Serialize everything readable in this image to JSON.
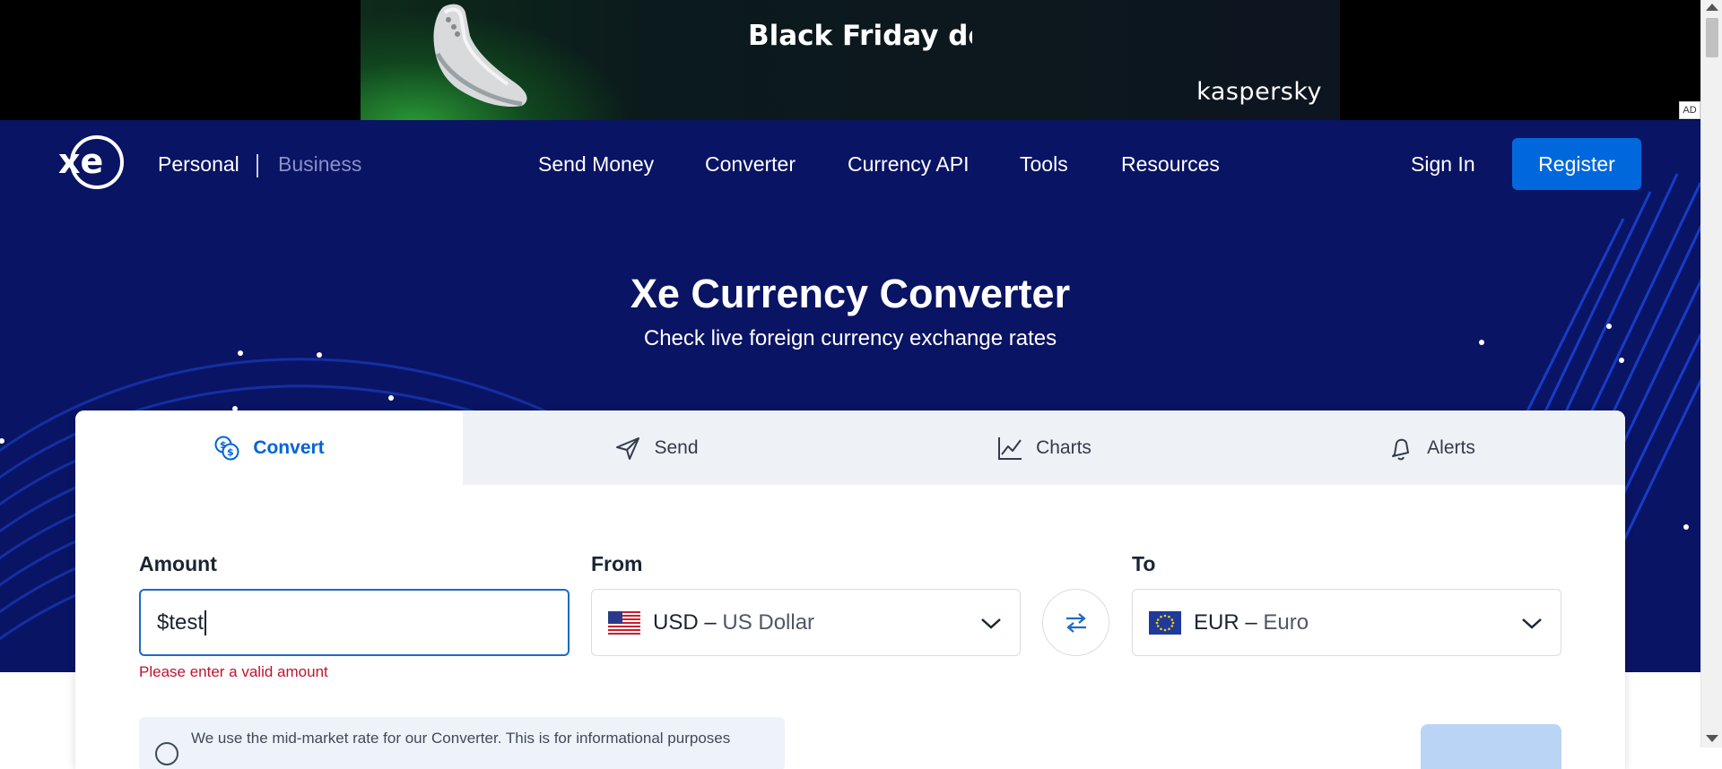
{
  "ad": {
    "headline": "Black Friday deals",
    "brand": "kaspersky",
    "tag": "AD"
  },
  "nav": {
    "personal": "Personal",
    "business": "Business",
    "links": [
      "Send Money",
      "Converter",
      "Currency API",
      "Tools",
      "Resources"
    ],
    "sign_in": "Sign In",
    "register": "Register"
  },
  "hero": {
    "title": "Xe Currency Converter",
    "subtitle": "Check live foreign currency exchange rates"
  },
  "tabs": [
    {
      "label": "Convert",
      "icon": "currency-exchange-icon",
      "active": true
    },
    {
      "label": "Send",
      "icon": "paper-plane-icon",
      "active": false
    },
    {
      "label": "Charts",
      "icon": "line-chart-icon",
      "active": false
    },
    {
      "label": "Alerts",
      "icon": "bell-icon",
      "active": false
    }
  ],
  "converter": {
    "amount_label": "Amount",
    "amount_value": "$test",
    "amount_error": "Please enter a valid amount",
    "from_label": "From",
    "from_code": "USD",
    "from_name": "US Dollar",
    "to_label": "To",
    "to_code": "EUR",
    "to_name": "Euro",
    "separator": " – ",
    "info_text": "We use the mid-market rate for our Converter. This is for informational purposes"
  },
  "colors": {
    "hero_bg": "#0a1464",
    "primary_blue": "#0068dc",
    "active_tab_text": "#0063dc",
    "error_red": "#c1132d"
  }
}
